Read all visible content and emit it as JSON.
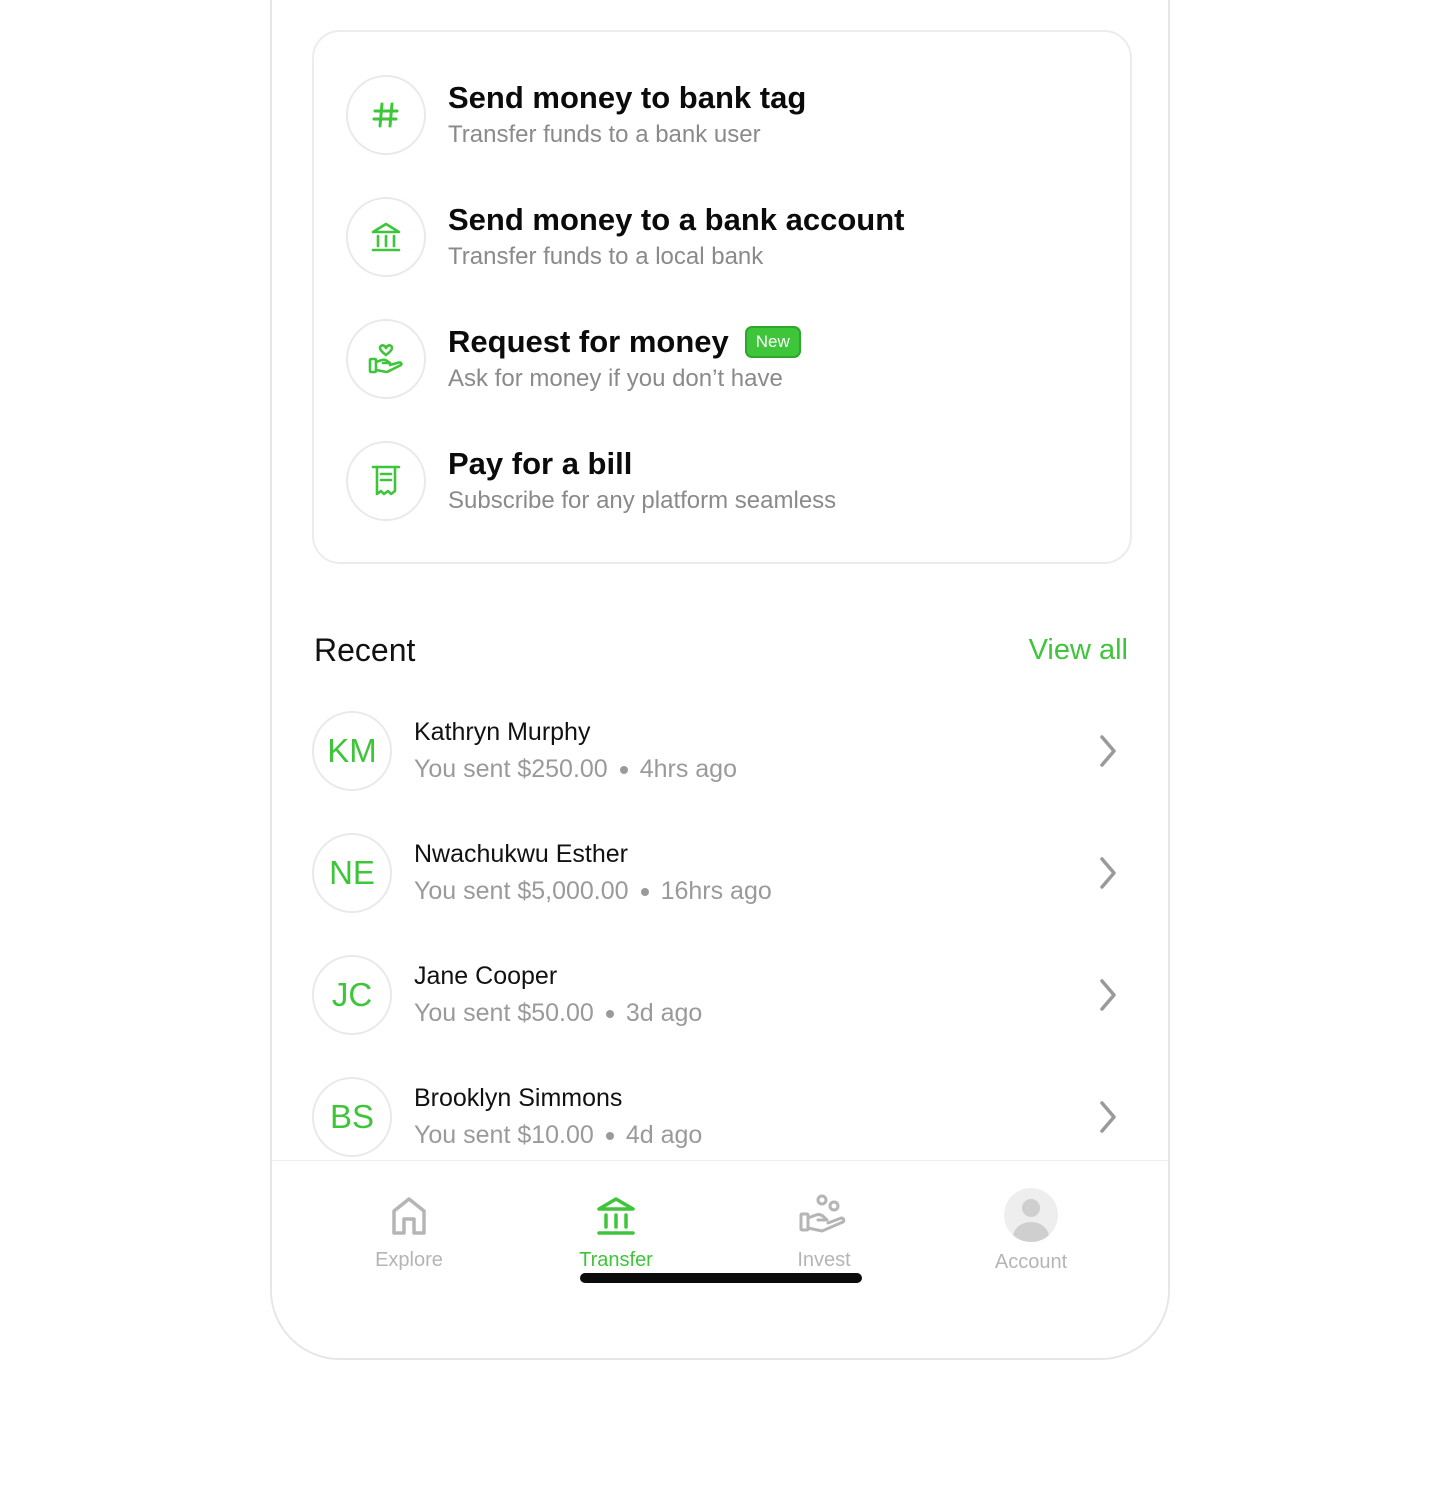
{
  "actions": [
    {
      "title": "Send money to bank tag",
      "subtitle": "Transfer funds to a bank user",
      "icon": "hash-icon"
    },
    {
      "title": "Send money to a bank account",
      "subtitle": "Transfer funds to a local bank",
      "icon": "bank-icon"
    },
    {
      "title": "Request for money",
      "subtitle": "Ask for money if you don’t have",
      "icon": "hand-heart-icon",
      "badge": "New"
    },
    {
      "title": "Pay for a bill",
      "subtitle": "Subscribe for any platform seamless",
      "icon": "receipt-icon"
    }
  ],
  "recent": {
    "title": "Recent",
    "view_all": "View all",
    "items": [
      {
        "initials": "KM",
        "name": "Kathryn Murphy",
        "amount": "You sent $250.00",
        "time": "4hrs ago"
      },
      {
        "initials": "NE",
        "name": "Nwachukwu Esther",
        "amount": "You sent $5,000.00",
        "time": "16hrs ago"
      },
      {
        "initials": "JC",
        "name": "Jane Cooper",
        "amount": "You sent $50.00",
        "time": "3d ago"
      },
      {
        "initials": "BS",
        "name": "Brooklyn Simmons",
        "amount": "You sent $10.00",
        "time": "4d ago"
      }
    ]
  },
  "tabbar": {
    "tabs": [
      {
        "label": "Explore",
        "icon": "home-icon",
        "active": false
      },
      {
        "label": "Transfer",
        "icon": "bank-icon",
        "active": true
      },
      {
        "label": "Invest",
        "icon": "hand-coins-icon",
        "active": false
      },
      {
        "label": "Account",
        "icon": "user-avatar-icon",
        "active": false
      }
    ]
  },
  "colors": {
    "accent": "#3ec53a",
    "text_primary": "#0b0b0b",
    "text_secondary": "#8a8a8a",
    "inactive": "#b5b5b5",
    "border": "#ececec"
  }
}
